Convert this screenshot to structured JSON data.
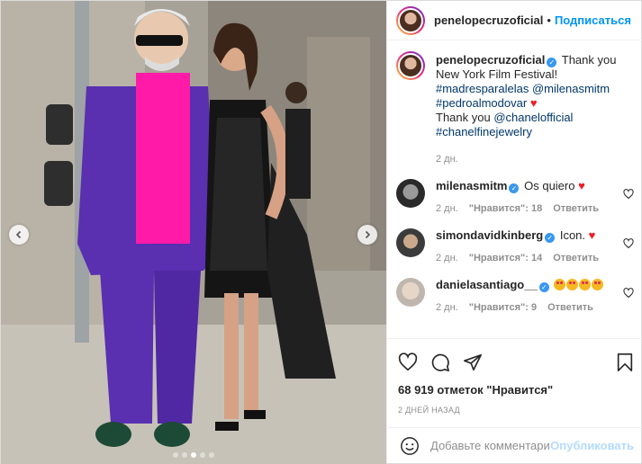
{
  "header": {
    "username": "penelopecruzoficial",
    "separator": "•",
    "follow_label": "Подписаться"
  },
  "caption": {
    "username": "penelopecruzoficial",
    "text1": "Thank you New York Film Festival!",
    "tag1": "#madresparalelas",
    "mention1": "@milenasmitm",
    "tag2": "#pedroalmodovar",
    "text2": "Thank you",
    "mention2": "@chanelofficial",
    "tag3": "#chanelfinejewelry",
    "time": "2 дн."
  },
  "comments": [
    {
      "username": "milenasmitm",
      "text": "Os quiero",
      "emoji": "heart",
      "time": "2 дн.",
      "likes": "\"Нравится\": 18",
      "reply": "Ответить"
    },
    {
      "username": "simondavidkinberg",
      "text": "Icon.",
      "emoji": "heart",
      "time": "2 дн.",
      "likes": "\"Нравится\": 14",
      "reply": "Ответить"
    },
    {
      "username": "danielasantiago__",
      "text": "",
      "emoji": "heart-eyes-x4",
      "time": "2 дн.",
      "likes": "\"Нравится\": 9",
      "reply": "Ответить"
    }
  ],
  "likes_text": "68 919 отметок \"Нравится\"",
  "date_text": "2 ДНЕЙ НАЗАД",
  "add_comment": {
    "placeholder": "Добавьте комментарий...",
    "publish_label": "Опубликовать"
  },
  "carousel": {
    "slides": 5,
    "active_index": 2
  },
  "colors": {
    "accent": "#0095f6",
    "link": "#00376b",
    "muted": "#8e8e8e",
    "heart": "#ed1c24"
  },
  "icons": [
    "chevron-left-icon",
    "chevron-right-icon",
    "heart-icon",
    "comment-icon",
    "share-icon",
    "bookmark-icon",
    "smile-icon",
    "verified-icon"
  ]
}
